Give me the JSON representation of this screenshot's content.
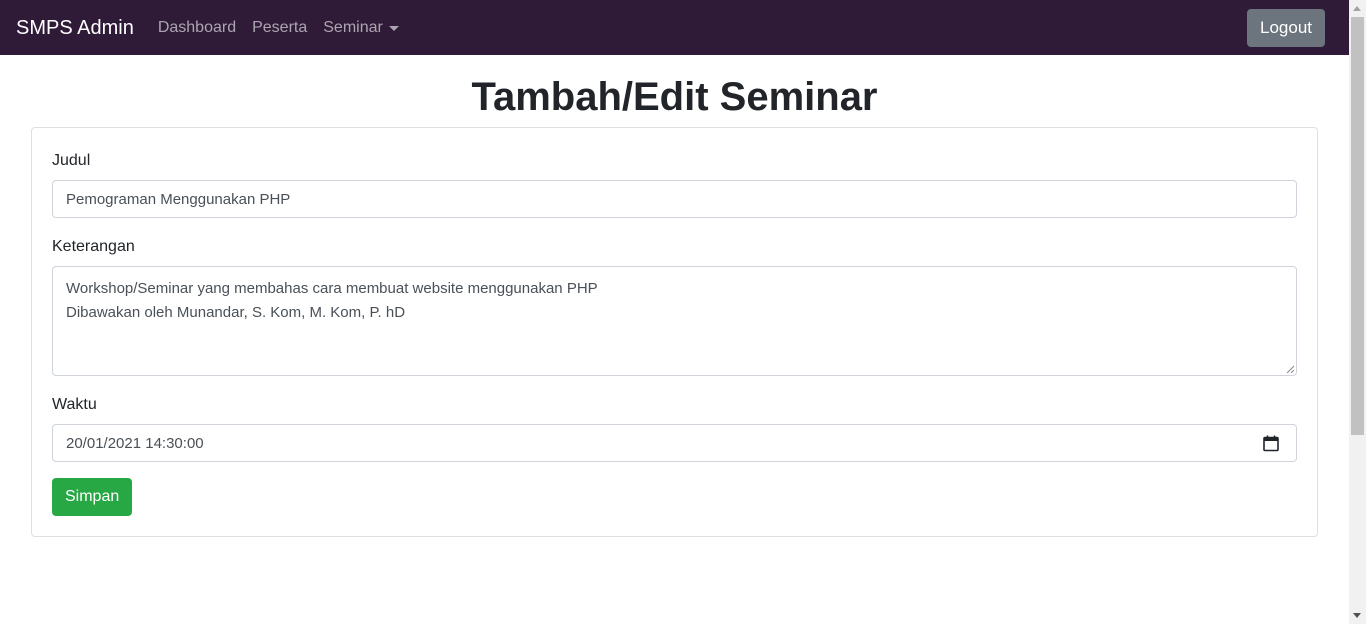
{
  "navbar": {
    "brand": "SMPS Admin",
    "links": [
      {
        "label": "Dashboard"
      },
      {
        "label": "Peserta"
      },
      {
        "label": "Seminar"
      }
    ],
    "logout_label": "Logout",
    "background": "#2f1a37"
  },
  "page": {
    "title": "Tambah/Edit Seminar"
  },
  "form": {
    "judul_label": "Judul",
    "judul_value": "Pemograman Menggunakan PHP",
    "keterangan_label": "Keterangan",
    "keterangan_lines": [
      "Workshop/Seminar yang membahas cara membuat website menggunakan PHP",
      "Dibawakan oleh Munandar, S. Kom, M. Kom, P. hD"
    ],
    "waktu_label": "Waktu",
    "waktu_value": "20/01/2021 14:30:00",
    "save_label": "Simpan",
    "save_color": "#28a745"
  },
  "icons": {
    "dropdown": "chevron-down-icon",
    "calendar": "calendar-icon",
    "resize": "resize-handle-icon"
  }
}
